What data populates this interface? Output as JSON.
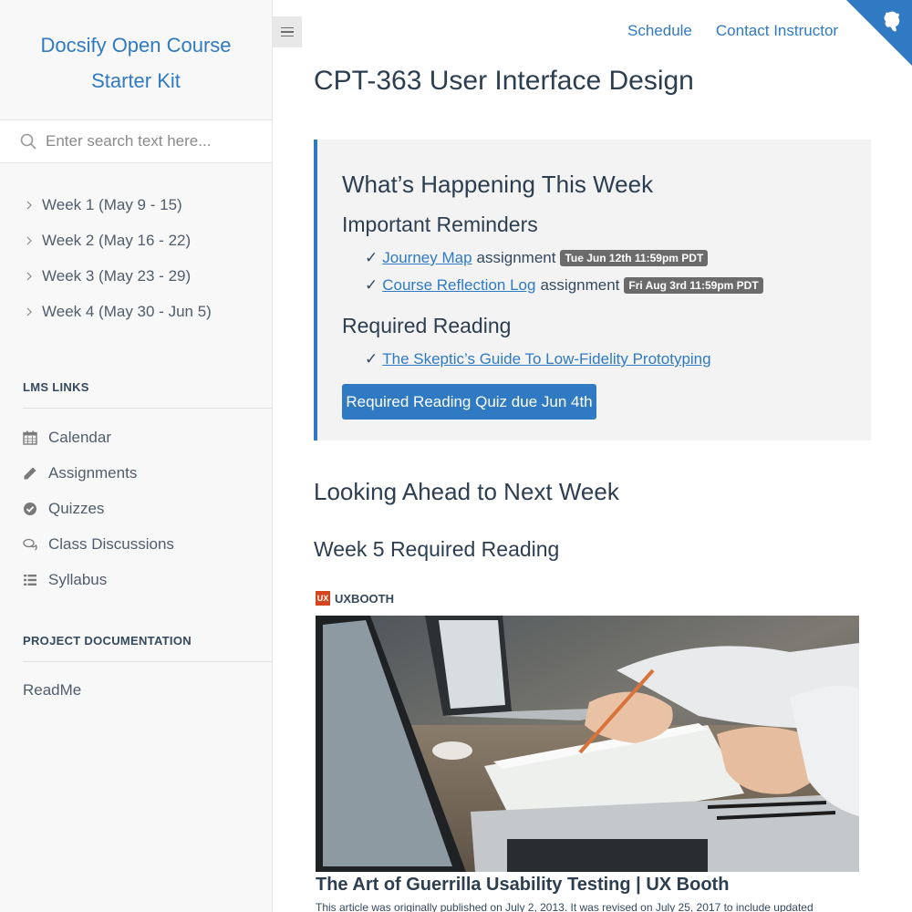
{
  "sidebar": {
    "app_name_line1": "Docsify Open Course",
    "app_name_line2": "Starter Kit",
    "search": {
      "placeholder": "Enter search text here..."
    },
    "weeks": [
      {
        "label": "Week 1 (May 9 - 15)"
      },
      {
        "label": "Week 2 (May 16 - 22)"
      },
      {
        "label": "Week 3 (May 23 - 29)"
      },
      {
        "label": "Week 4 (May 30 - Jun 5)"
      }
    ],
    "lms_links_title": "LMS LINKS",
    "lms_links": [
      {
        "label": "Calendar",
        "icon": "calendar-icon"
      },
      {
        "label": "Assignments",
        "icon": "pencil-icon"
      },
      {
        "label": "Quizzes",
        "icon": "check-circle-icon"
      },
      {
        "label": "Class Discussions",
        "icon": "comments-icon"
      },
      {
        "label": "Syllabus",
        "icon": "list-icon"
      }
    ],
    "project_docs_title": "PROJECT DOCUMENTATION",
    "project_docs": [
      {
        "label": "ReadMe"
      }
    ]
  },
  "topnav": {
    "schedule": "Schedule",
    "contact": "Contact Instructor"
  },
  "main": {
    "title": "CPT-363 User Interface Design",
    "this_week": {
      "heading": "What’s Happening This Week",
      "reminders_heading": "Important Reminders",
      "reminders": [
        {
          "check": "✓",
          "link": "Journey Map",
          "text": "assignment",
          "badge": "Tue Jun 12th 11:59pm PDT"
        },
        {
          "check": "✓",
          "link": "Course Reflection Log",
          "text": "assignment",
          "badge": "Fri Aug 3rd 11:59pm PDT"
        }
      ],
      "reading_heading": "Required Reading",
      "reading": {
        "check": "✓",
        "link": "The Skeptic’s Guide To Low-Fidelity Prototyping"
      },
      "quiz_button": "Required Reading Quiz due Jun 4th"
    },
    "next_week_heading": "Looking Ahead to Next Week",
    "week5_heading": "Week 5 Required Reading",
    "article": {
      "source_logo": "UX",
      "source": "UXBOOTH",
      "title": "The Art of Guerrilla Usability Testing | UX Booth",
      "description": "This article was originally published on July 2, 2013. It was revised on July 25, 2017 to include updated"
    }
  },
  "colors": {
    "accent": "#2f7ac3",
    "sidebar_bg": "#f8f8f8",
    "tip_bg": "#f3f3f3",
    "badge_bg": "#6b6b6b"
  }
}
